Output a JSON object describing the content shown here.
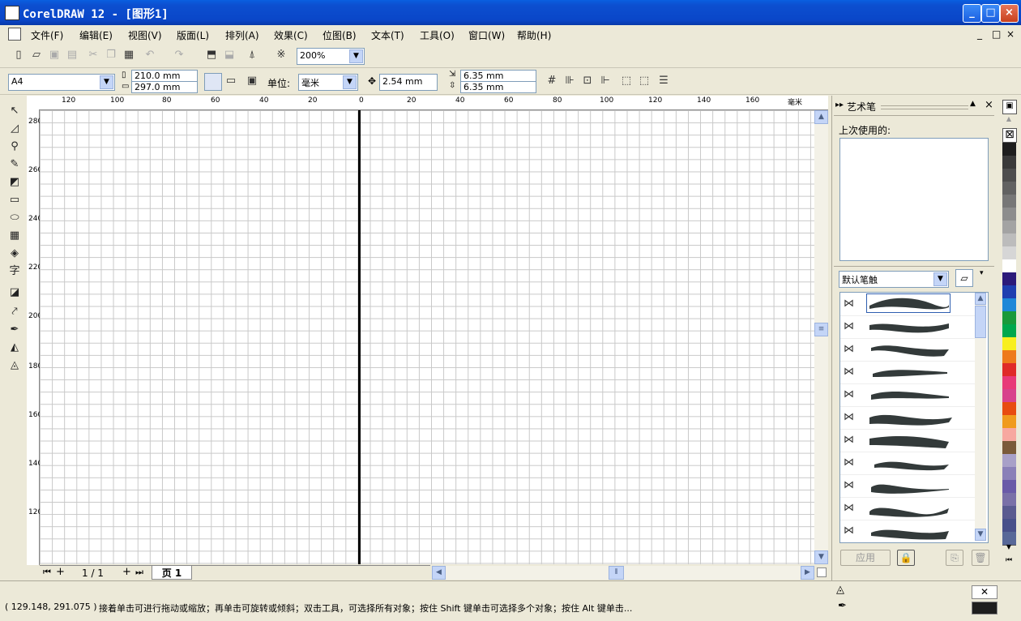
{
  "window": {
    "title": "CorelDRAW 12 - [图形1]",
    "minimize": "_",
    "maximize": "□",
    "close": "×"
  },
  "menu": {
    "items": [
      "文件(F)",
      "编辑(E)",
      "视图(V)",
      "版面(L)",
      "排列(A)",
      "效果(C)",
      "位图(B)",
      "文本(T)",
      "工具(O)",
      "窗口(W)",
      "帮助(H)"
    ],
    "doc_controls": [
      "_",
      "□",
      "×"
    ]
  },
  "standard_toolbar": {
    "zoom": "200%"
  },
  "property_bar": {
    "paper": "A4",
    "width": "210.0 mm",
    "height": "297.0 mm",
    "units_label": "单位:",
    "units": "毫米",
    "nudge": "2.54 mm",
    "dup_x": "6.35 mm",
    "dup_y": "6.35 mm"
  },
  "rulers": {
    "horizontal": [
      "120",
      "100",
      "80",
      "60",
      "40",
      "20",
      "0",
      "20",
      "40",
      "60",
      "80",
      "100",
      "120",
      "140",
      "160"
    ],
    "h_unit": "毫米",
    "vertical": [
      "280",
      "260",
      "240",
      "220",
      "200",
      "180",
      "160",
      "140",
      "120"
    ]
  },
  "page_nav": {
    "counter": "1 / 1",
    "tab": "页 1"
  },
  "docker": {
    "title": "艺术笔",
    "recent_label": "上次使用的:",
    "brush_select": "默认笔触",
    "apply": "应用",
    "brush_count": 11
  },
  "palette": {
    "colors": [
      "#1e1e1e",
      "#3a3a3a",
      "#4e4e4e",
      "#626262",
      "#777777",
      "#8d8d8d",
      "#a3a3a3",
      "#bcbcbc",
      "#d6d6d6",
      "#ffffff",
      "#2c1a7a",
      "#1f3fb0",
      "#1e88d8",
      "#1a9a3a",
      "#00a84c",
      "#f8ef1e",
      "#ee7a1c",
      "#e02a28",
      "#e83a78",
      "#d8428c",
      "#e84c10",
      "#f09b1e",
      "#f7a8a0",
      "#7a5a3a",
      "#a8a0c8",
      "#8a80b8",
      "#6a5aa8",
      "#7a70a8",
      "#5a5a90",
      "#48508a",
      "#586898"
    ]
  },
  "status": {
    "coords": "( 129.148, 291.075 )",
    "hint": "接着单击可进行拖动或缩放；再单击可旋转或倾斜；双击工具，可选择所有对象；按住 Shift 键单击可选择多个对象；按住 Alt 键单击..."
  }
}
